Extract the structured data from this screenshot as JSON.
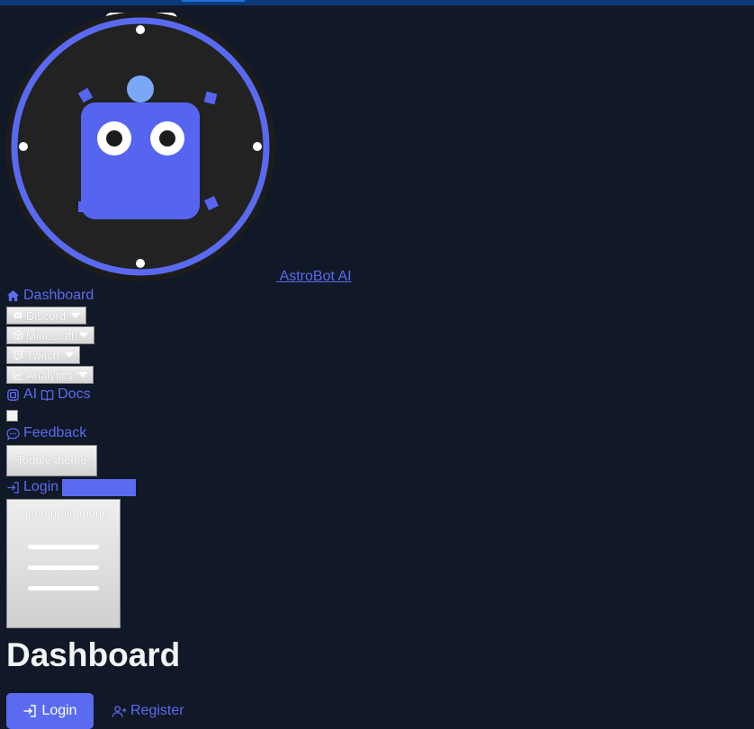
{
  "brand": {
    "name": "AstroBot AI"
  },
  "nav": {
    "dashboard": "Dashboard",
    "discord": "Discord",
    "minecraft": "Minecraft",
    "twitch": "Twitch",
    "analytics": "Analytics",
    "ai": "AI",
    "docs": "Docs",
    "feedback": "Feedback",
    "toggle_theme": "Toggle theme",
    "login": "Login",
    "open_main_menu": "Open main menu"
  },
  "main": {
    "title": "Dashboard",
    "login_button": "Login",
    "register_link": "Register"
  },
  "colors": {
    "background": "#111827",
    "accent": "#5b6bf0",
    "logo_ring": "#5a6af0",
    "logo_face": "#222222"
  },
  "icons": [
    "home-icon",
    "discord-icon",
    "cube-icon",
    "twitch-icon",
    "chart-icon",
    "cpu-icon",
    "book-icon",
    "chat-icon",
    "login-icon",
    "user-plus-icon",
    "hamburger-icon"
  ]
}
